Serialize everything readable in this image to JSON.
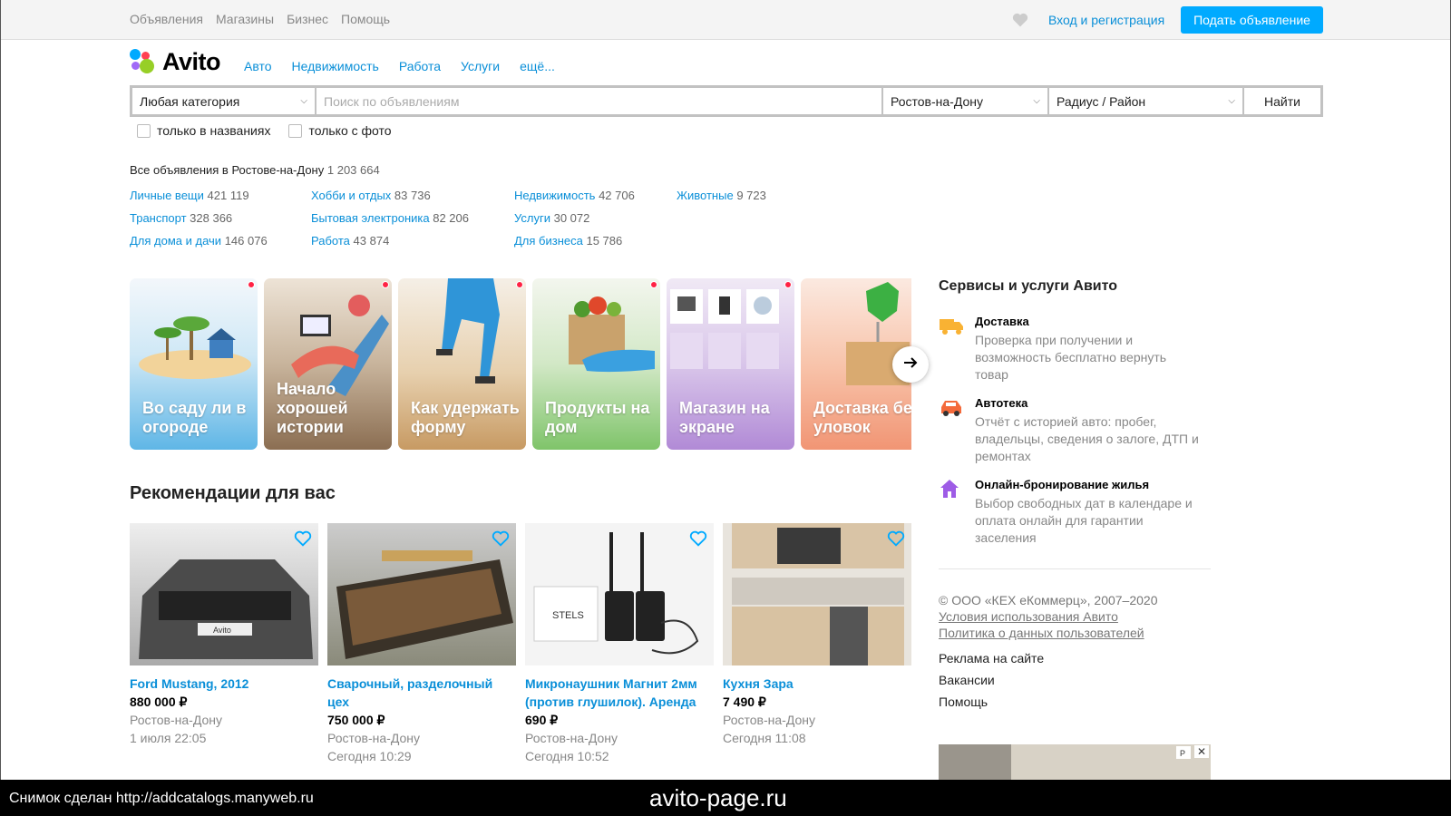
{
  "topbar": {
    "nav": [
      "Объявления",
      "Магазины",
      "Бизнес",
      "Помощь"
    ],
    "login": "Вход и регистрация",
    "post_ad": "Подать объявление"
  },
  "logo": {
    "text": "Avito",
    "colors": [
      "#0af",
      "#ff4053",
      "#97cf26",
      "#a169f7"
    ]
  },
  "catnav": [
    "Авто",
    "Недвижимость",
    "Работа",
    "Услуги",
    "ещё..."
  ],
  "search": {
    "category": "Любая категория",
    "placeholder": "Поиск по объявлениям",
    "city": "Ростов-на-Дону",
    "radius": "Радиус / Район",
    "find": "Найти",
    "check_titles": "только в названиях",
    "check_photo": "только с фото"
  },
  "all_ads": {
    "label": "Все объявления в Ростове-на-Дону",
    "count": "1 203 664"
  },
  "categories": [
    [
      {
        "name": "Личные вещи",
        "count": "421 119"
      },
      {
        "name": "Транспорт",
        "count": "328 366"
      },
      {
        "name": "Для дома и дачи",
        "count": "146 076"
      }
    ],
    [
      {
        "name": "Хобби и отдых",
        "count": "83 736"
      },
      {
        "name": "Бытовая электроника",
        "count": "82 206"
      },
      {
        "name": "Работа",
        "count": "43 874"
      }
    ],
    [
      {
        "name": "Недвижимость",
        "count": "42 706"
      },
      {
        "name": "Услуги",
        "count": "30 072"
      },
      {
        "name": "Для бизнеса",
        "count": "15 786"
      }
    ],
    [
      {
        "name": "Животные",
        "count": "9 723"
      }
    ]
  ],
  "stories": [
    {
      "title": "Во саду ли в огороде",
      "bg": "#7cc6ec"
    },
    {
      "title": "Начало хорошей истории",
      "bg": "#a38a70"
    },
    {
      "title": "Как удержать форму",
      "bg": "#d8b17c"
    },
    {
      "title": "Продукты на дом",
      "bg": "#8fcc7c"
    },
    {
      "title": "Магазин на экране",
      "bg": "#b99ad8"
    },
    {
      "title": "Доставка без уловок",
      "bg": "#f6a986"
    }
  ],
  "recommendations": {
    "title": "Рекомендации для вас",
    "items": [
      {
        "title": "Ford Mustang, 2012",
        "price": "880 000 ₽",
        "location": "Ростов-на-Дону",
        "date": "1 июля 22:05",
        "plate": "Avito"
      },
      {
        "title": "Сварочный, разделочный цех",
        "price": "750 000 ₽",
        "location": "Ростов-на-Дону",
        "date": "Сегодня 10:29"
      },
      {
        "title": "Микронаушник Магнит 2мм (против глушилок). Аренда",
        "price": "690 ₽",
        "location": "Ростов-на-Дону",
        "date": "Сегодня 10:52",
        "brand": "STELS"
      },
      {
        "title": "Кухня Зара",
        "price": "7 490 ₽",
        "location": "Ростов-на-Дону",
        "date": "Сегодня 11:08"
      }
    ]
  },
  "services": {
    "title": "Сервисы и услуги Авито",
    "items": [
      {
        "name": "Доставка",
        "desc": "Проверка при получении и возможность бесплатно вернуть товар",
        "icon": "truck-icon",
        "color": "#f9b233"
      },
      {
        "name": "Автотека",
        "desc": "Отчёт с историей авто: пробег, владельцы, сведения о залоге, ДТП и ремонтах",
        "icon": "car-icon",
        "color": "#f46a3b"
      },
      {
        "name": "Онлайн-бронирование жилья",
        "desc": "Выбор свободных дат в календаре и оплата онлайн для гарантии заселения",
        "icon": "house-icon",
        "color": "#9e5ce6"
      }
    ]
  },
  "legal": {
    "copyright": "© ООО «КЕХ еКоммерц», 2007–2020",
    "terms": "Условия использования Авито",
    "privacy": "Политика о данных пользователей"
  },
  "links": [
    "Реклама на сайте",
    "Вакансии",
    "Помощь"
  ],
  "ad_badge": "P",
  "footer": {
    "left": "Снимок сделан http://addcatalogs.manyweb.ru",
    "center": "avito-page.ru"
  }
}
